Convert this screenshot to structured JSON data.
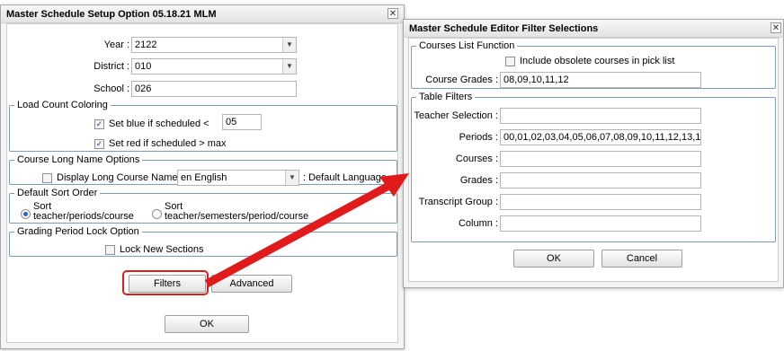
{
  "left_dialog": {
    "title": "Master Schedule Setup Option 05.18.21 MLM",
    "close_glyph": "✕",
    "year_label": "Year :",
    "year_value": "2122",
    "district_label": "District :",
    "district_value": "010",
    "school_label": "School :",
    "school_value": "026",
    "load_count": {
      "legend": "Load Count Coloring",
      "blue_label": "Set blue if scheduled <",
      "blue_checked": true,
      "blue_value": "05",
      "red_label": "Set red if scheduled > max",
      "red_checked": true
    },
    "long_name": {
      "legend": "Course Long Name Options",
      "display_label": "Display Long Course Names",
      "display_checked": false,
      "language_value": "en English",
      "default_language": ": Default Language"
    },
    "sort_order": {
      "legend": "Default Sort Order",
      "option1_line1": "Sort",
      "option1_line2": "teacher/periods/course",
      "option1_selected": true,
      "option2_line1": "Sort",
      "option2_line2": "teacher/semesters/period/course",
      "option2_selected": false
    },
    "grading_lock": {
      "legend": "Grading Period Lock Option",
      "lock_label": "Lock New Sections",
      "lock_checked": false
    },
    "buttons": {
      "filters": "Filters",
      "advanced": "Advanced",
      "ok": "OK"
    }
  },
  "right_dialog": {
    "title": "Master Schedule Editor Filter Selections",
    "close_glyph": "✕",
    "courses_list": {
      "legend": "Courses List Function",
      "obsolete_label": "Include obsolete courses in pick list",
      "obsolete_checked": false,
      "course_grades_label": "Course Grades :",
      "course_grades_value": "08,09,10,11,12"
    },
    "table_filters": {
      "legend": "Table Filters",
      "teacher_label": "Teacher Selection :",
      "teacher_value": "",
      "periods_label": "Periods :",
      "periods_value": "00,01,02,03,04,05,06,07,08,09,10,11,12,13,1...",
      "courses_label": "Courses :",
      "courses_value": "",
      "grades_label": "Grades :",
      "grades_value": "",
      "transcript_label": "Transcript Group :",
      "transcript_value": "",
      "column_label": "Column :",
      "column_value": ""
    },
    "buttons": {
      "ok": "OK",
      "cancel": "Cancel"
    }
  },
  "colors": {
    "annotation_red": "#e11b1b",
    "radio_selected": "#2a63c8",
    "fieldset_border": "#7f9db9"
  }
}
